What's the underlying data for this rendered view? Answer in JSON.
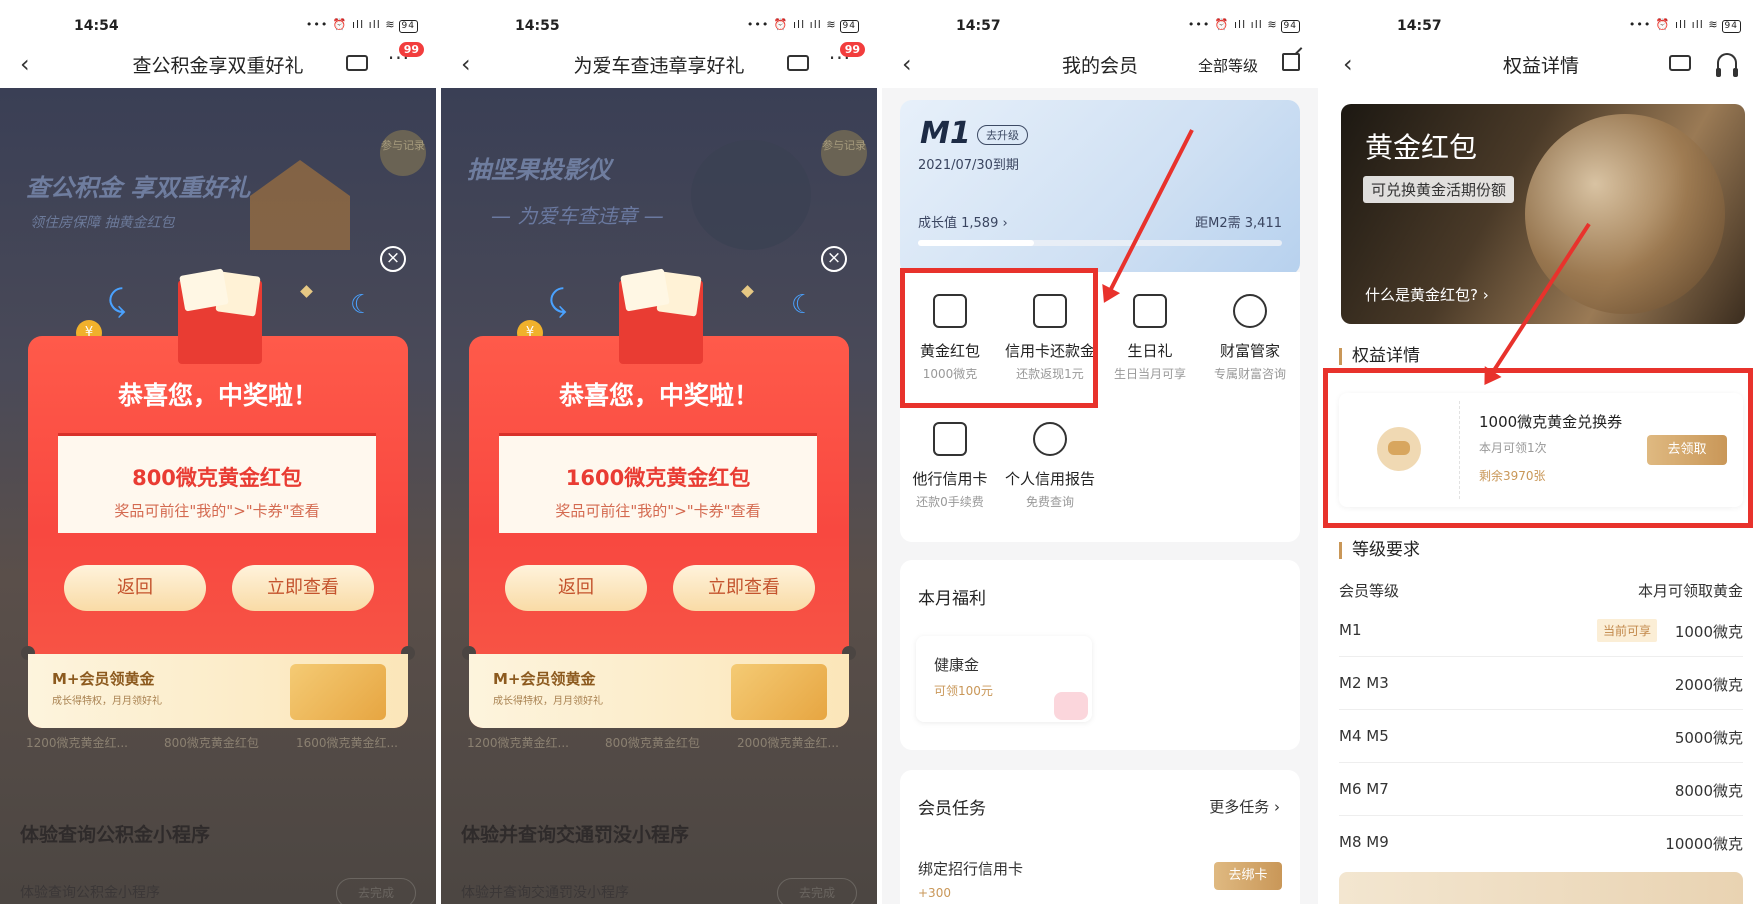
{
  "panels": [
    {
      "time": "14:54",
      "title": "查公积金享双重好礼",
      "badge": "99",
      "bg_title": "查公积金 享双重好礼",
      "bg_sub": "领住房保障 抽黄金红包",
      "side_tag": "参与记录",
      "heading": "恭喜您，中奖啦！",
      "prize": "800微克黄金红包",
      "hint": "奖品可前往\"我的\">\"卡券\"查看",
      "btn_back": "返回",
      "btn_view": "立即查看",
      "banner_title": "M+会员领黄金",
      "banner_sub": "成长得特权，月月领好礼",
      "tabs": [
        "1200微克黄金红...",
        "800微克黄金红包",
        "1600微克黄金红..."
      ],
      "section_title": "体验查询公积金小程序",
      "section_sub": "体验查询公积金小程序",
      "section_btn": "去完成"
    },
    {
      "time": "14:55",
      "title": "为爱车查违章享好礼",
      "badge": "99",
      "bg_title": "抽坚果投影仪",
      "bg_sub": "— 为爱车查违章 —",
      "side_tag": "参与记录",
      "heading": "恭喜您，中奖啦！",
      "prize": "1600微克黄金红包",
      "hint": "奖品可前往\"我的\">\"卡券\"查看",
      "btn_back": "返回",
      "btn_view": "立即查看",
      "banner_title": "M+会员领黄金",
      "banner_sub": "成长得特权，月月领好礼",
      "tabs": [
        "1200微克黄金红...",
        "800微克黄金红包",
        "2000微克黄金红..."
      ],
      "section_title": "体验并查询交通罚没小程序",
      "section_sub": "体验并查询交通罚没小程序",
      "section_btn": "去完成"
    }
  ],
  "member": {
    "time": "14:57",
    "title": "我的会员",
    "all_levels": "全部等级",
    "level": "M1",
    "upgrade": "去升级",
    "expiry": "2021/07/30到期",
    "growth": "成长值 1,589 ›",
    "need": "距M2需 3,411",
    "growth_ratio": 0.32,
    "benefits": [
      {
        "name": "黄金红包",
        "desc": "1000微克"
      },
      {
        "name": "信用卡还款金",
        "desc": "还款返现1元"
      },
      {
        "name": "生日礼",
        "desc": "生日当月可享"
      },
      {
        "name": "财富管家",
        "desc": "专属财富咨询"
      },
      {
        "name": "他行信用卡",
        "desc": "还款0手续费"
      },
      {
        "name": "个人信用报告",
        "desc": "免费查询"
      }
    ],
    "monthly_title": "本月福利",
    "health_name": "健康金",
    "health_desc": "可领100元",
    "tasks_title": "会员任务",
    "more_tasks": "更多任务 ›",
    "task_name": "绑定招行信用卡",
    "task_points": "+300",
    "bind_btn": "去绑卡"
  },
  "detail": {
    "time": "14:57",
    "title": "权益详情",
    "hero_title": "黄金红包",
    "hero_tag": "可兑换黄金活期份额",
    "hero_link": "什么是黄金红包? ›",
    "section_benefit": "权益详情",
    "coupon_name": "1000微克黄金兑换券",
    "coupon_quota": "本月可领1次",
    "coupon_left": "剩余3970张",
    "get_btn": "去领取",
    "section_level": "等级要求",
    "col_level": "会员等级",
    "col_amount": "本月可领取黄金",
    "current_tag": "当前可享",
    "rows": [
      {
        "level": "M1",
        "amount": "1000微克"
      },
      {
        "level": "M2   M3",
        "amount": "2000微克"
      },
      {
        "level": "M4   M5",
        "amount": "5000微克"
      },
      {
        "level": "M6   M7",
        "amount": "8000微克"
      },
      {
        "level": "M8   M9",
        "amount": "10000微克"
      }
    ]
  },
  "colors": {
    "red": "#e8322c",
    "gold": "#c99758",
    "modal": "#f84840"
  }
}
